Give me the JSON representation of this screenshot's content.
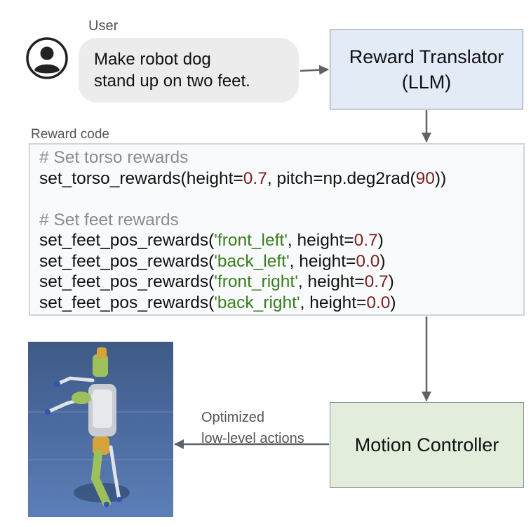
{
  "user": {
    "label": "User",
    "message_lines": [
      "Make robot dog",
      "stand up on two feet."
    ]
  },
  "reward_translator": {
    "line1": "Reward Translator",
    "line2": "(LLM)"
  },
  "reward_code": {
    "label": "Reward code",
    "lines": [
      [
        {
          "t": "# Set torso rewards",
          "c": "comment"
        }
      ],
      [
        {
          "t": "set_torso_rewards(height=",
          "c": "plain"
        },
        {
          "t": "0.7",
          "c": "num"
        },
        {
          "t": ", pitch=np.deg2rad(",
          "c": "plain"
        },
        {
          "t": "90",
          "c": "num"
        },
        {
          "t": "))",
          "c": "plain"
        }
      ],
      [],
      [
        {
          "t": "# Set feet rewards",
          "c": "comment"
        }
      ],
      [
        {
          "t": "set_feet_pos_rewards(",
          "c": "plain"
        },
        {
          "t": "'front_left'",
          "c": "str"
        },
        {
          "t": ", height=",
          "c": "plain"
        },
        {
          "t": "0.7",
          "c": "num"
        },
        {
          "t": ")",
          "c": "plain"
        }
      ],
      [
        {
          "t": "set_feet_pos_rewards(",
          "c": "plain"
        },
        {
          "t": "'back_left'",
          "c": "str"
        },
        {
          "t": ", height=",
          "c": "plain"
        },
        {
          "t": "0.0",
          "c": "num"
        },
        {
          "t": ")",
          "c": "plain"
        }
      ],
      [
        {
          "t": "set_feet_pos_rewards(",
          "c": "plain"
        },
        {
          "t": "'front_right'",
          "c": "str"
        },
        {
          "t": ", height=",
          "c": "plain"
        },
        {
          "t": "0.7",
          "c": "num"
        },
        {
          "t": ")",
          "c": "plain"
        }
      ],
      [
        {
          "t": "set_feet_pos_rewards(",
          "c": "plain"
        },
        {
          "t": "'back_right'",
          "c": "str"
        },
        {
          "t": ", height=",
          "c": "plain"
        },
        {
          "t": "0.0",
          "c": "num"
        },
        {
          "t": ")",
          "c": "plain"
        }
      ]
    ]
  },
  "motion_controller": {
    "label": "Motion Controller"
  },
  "optimized_actions": {
    "lines": [
      "Optimized",
      "low-level actions"
    ]
  },
  "colors": {
    "translator_fill": "#e3ebf6",
    "controller_fill": "#e2eedb",
    "bubble_fill": "#ececec",
    "code_number": "#7a1f1f",
    "code_string": "#3a7d1e",
    "code_comment": "#8c8c8c",
    "arrow": "#5f6368"
  },
  "icons": {
    "avatar": "user-avatar-icon",
    "image": "robot-dog-simulation-image"
  }
}
